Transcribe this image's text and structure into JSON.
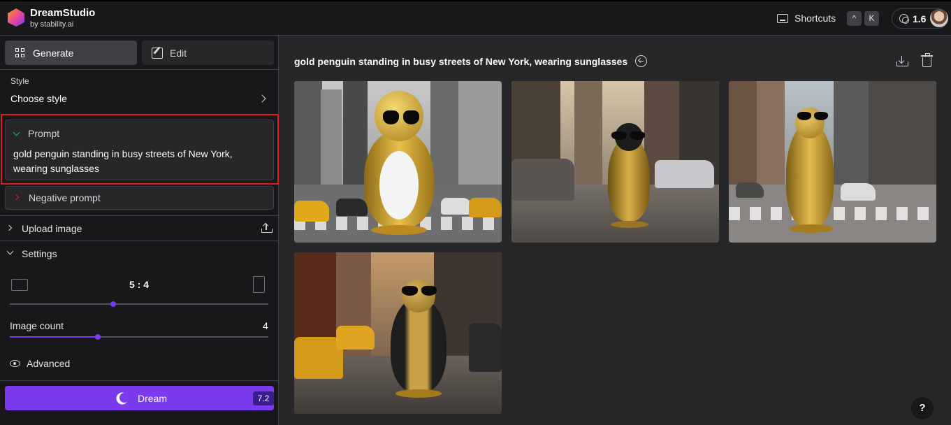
{
  "header": {
    "brand_title": "DreamStudio",
    "brand_subtitle": "by stability.ai",
    "shortcuts_label": "Shortcuts",
    "shortcut_keys": [
      "^",
      "K"
    ],
    "credits": "1.6"
  },
  "sidebar": {
    "tabs": [
      {
        "label": "Generate",
        "icon": "grid-icon",
        "active": true
      },
      {
        "label": "Edit",
        "icon": "edit-icon",
        "active": false
      }
    ],
    "style": {
      "label": "Style",
      "value": "Choose style"
    },
    "prompt": {
      "label": "Prompt",
      "text": "gold penguin standing in busy streets of New York, wearing sunglasses"
    },
    "negative_prompt": {
      "label": "Negative prompt"
    },
    "upload": {
      "label": "Upload image"
    },
    "settings": {
      "label": "Settings",
      "aspect_ratio": "5 : 4",
      "aspect_slider_fraction": 0.4,
      "image_count_label": "Image count",
      "image_count_value": "4",
      "image_count_fraction": 0.34
    },
    "advanced_label": "Advanced",
    "dream_button": {
      "label": "Dream",
      "cost": "7.2"
    }
  },
  "main": {
    "title": "gold penguin standing in busy streets of New York, wearing sunglasses",
    "images": [
      {
        "name": "generated-image-1"
      },
      {
        "name": "generated-image-2"
      },
      {
        "name": "generated-image-3"
      },
      {
        "name": "generated-image-4"
      }
    ]
  },
  "help_label": "?",
  "colors": {
    "accent": "#7c3aed",
    "highlight": "#e11d1d",
    "sidebar_bg": "#18181b",
    "main_bg": "#27272a"
  }
}
